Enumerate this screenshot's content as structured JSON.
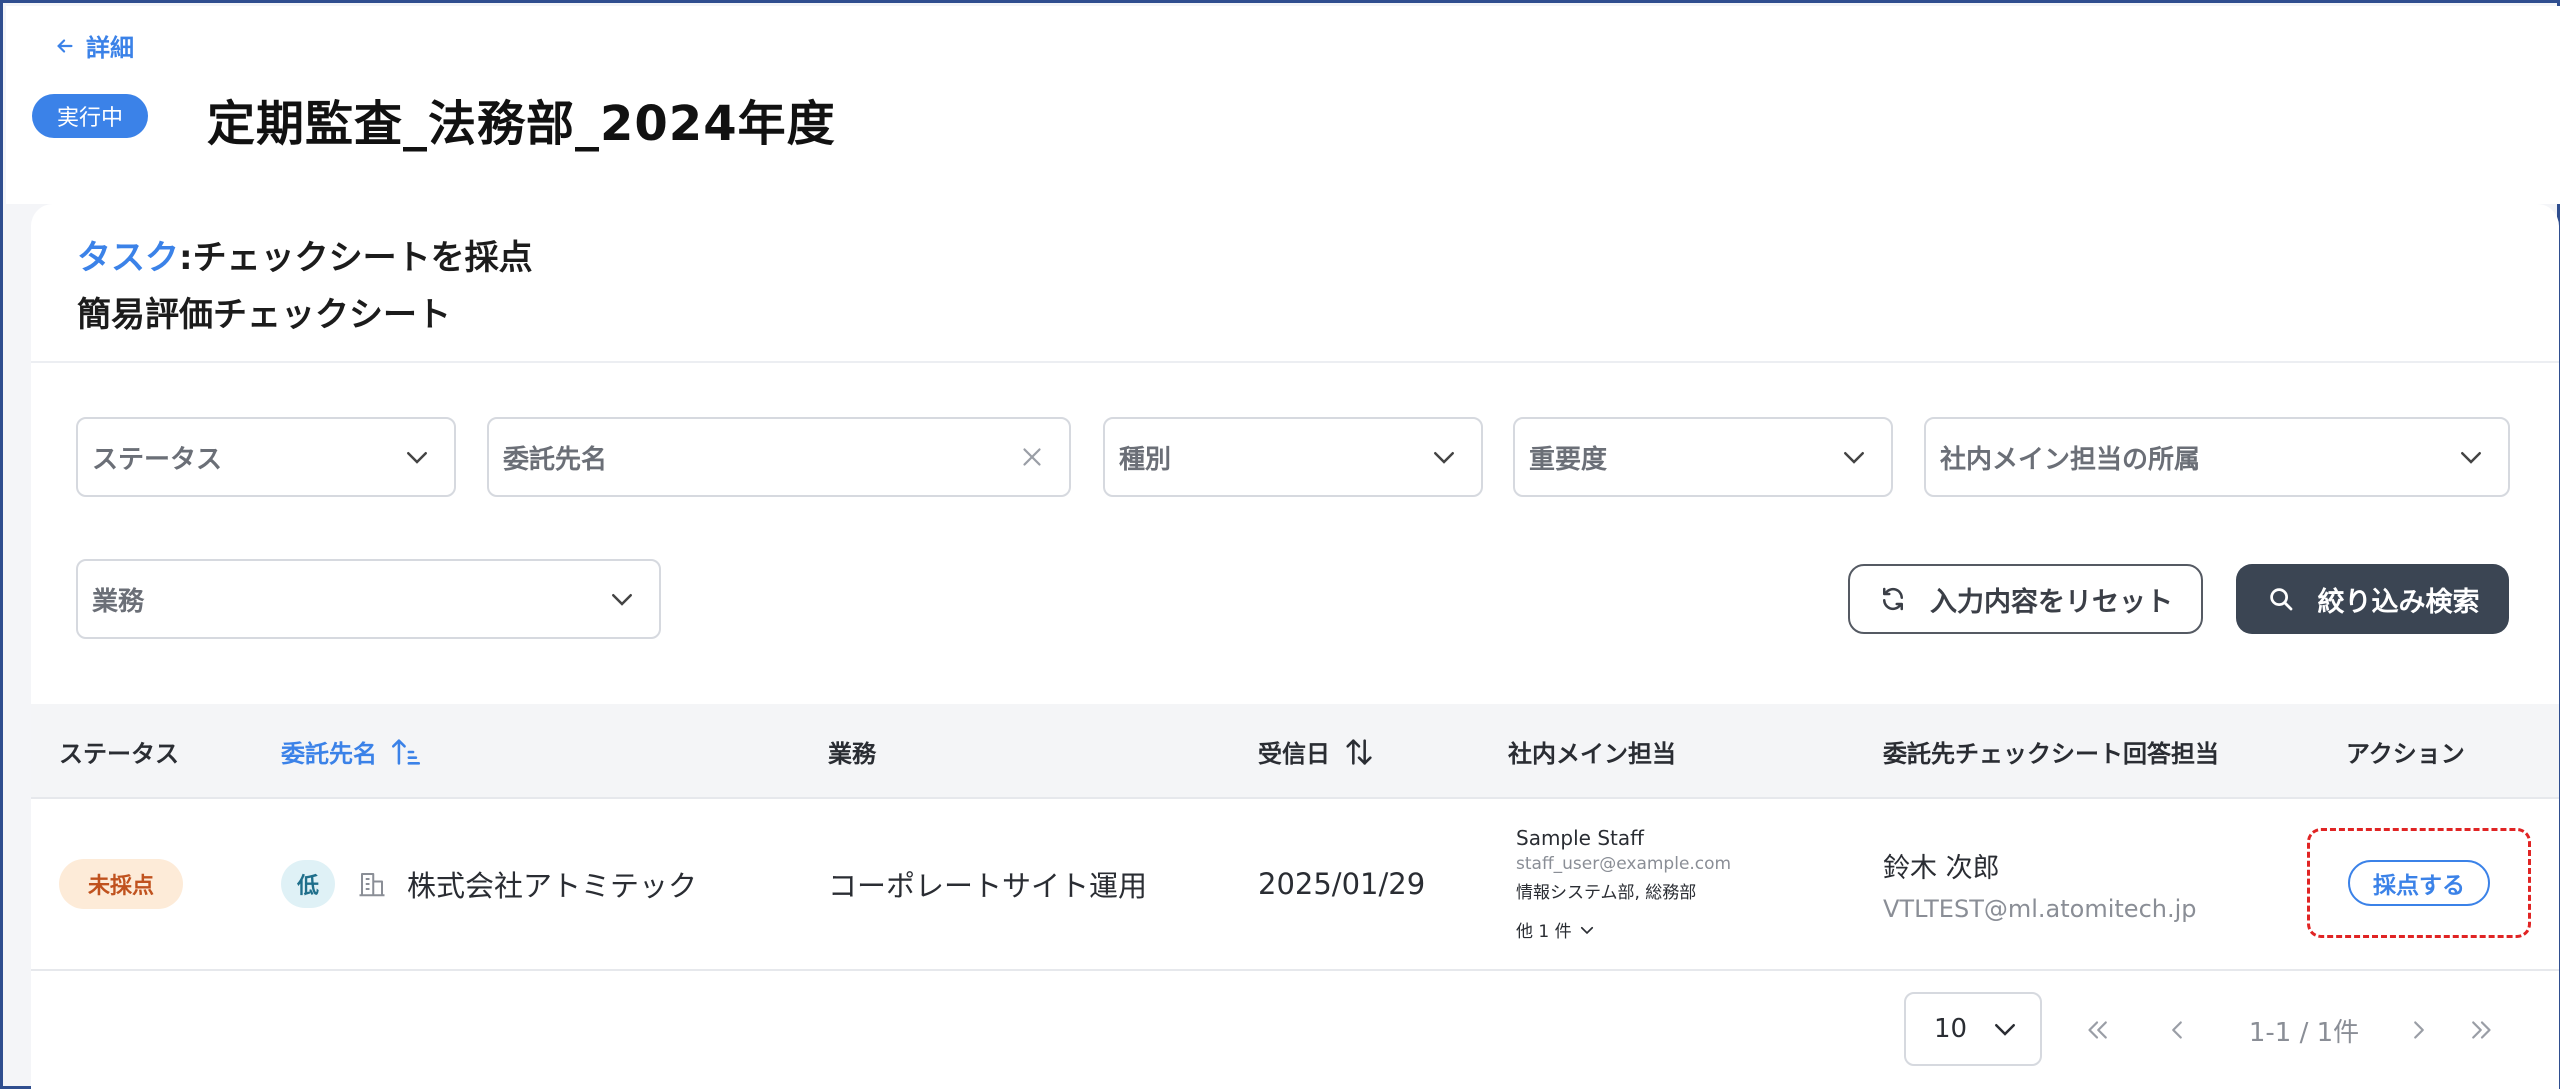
{
  "header": {
    "back_label": "詳細",
    "status": "実行中",
    "title": "定期監査_法務部_2024年度"
  },
  "task": {
    "prefix": "タスク",
    "separator": ":",
    "name": "チェックシートを採点",
    "sheet": "簡易評価チェックシート"
  },
  "filters": {
    "status": "ステータス",
    "contractor": "委託先名",
    "type": "種別",
    "importance": "重要度",
    "department": "社内メイン担当の所属",
    "business": "業務",
    "reset_label": "入力内容をリセット",
    "search_label": "絞り込み検索"
  },
  "table": {
    "columns": {
      "status": "ステータス",
      "contractor": "委託先名",
      "business": "業務",
      "received": "受信日",
      "main_staff": "社内メイン担当",
      "responder": "委託先チェックシート回答担当",
      "action": "アクション"
    },
    "rows": [
      {
        "status": "未採点",
        "importance": "低",
        "contractor": "株式会社アトミテック",
        "business": "コーポレートサイト運用",
        "received": "2025/01/29",
        "staff_name": "Sample Staff",
        "staff_email": "staff_user@example.com",
        "staff_dept": "情報システム部, 総務部",
        "staff_more": "他 1 件",
        "responder_name": "鈴木 次郎",
        "responder_email": "VTLTEST@ml.atomitech.jp",
        "action_label": "採点する"
      }
    ]
  },
  "pagination": {
    "page_size": "10",
    "range": "1-1 / 1件"
  },
  "colors": {
    "accent": "#3b82e8",
    "dark_button": "#3b4553",
    "frame_border": "#2f4e8f",
    "highlight_border": "#e02424",
    "unscored_bg": "#fdebd8",
    "unscored_text": "#c0521e"
  }
}
